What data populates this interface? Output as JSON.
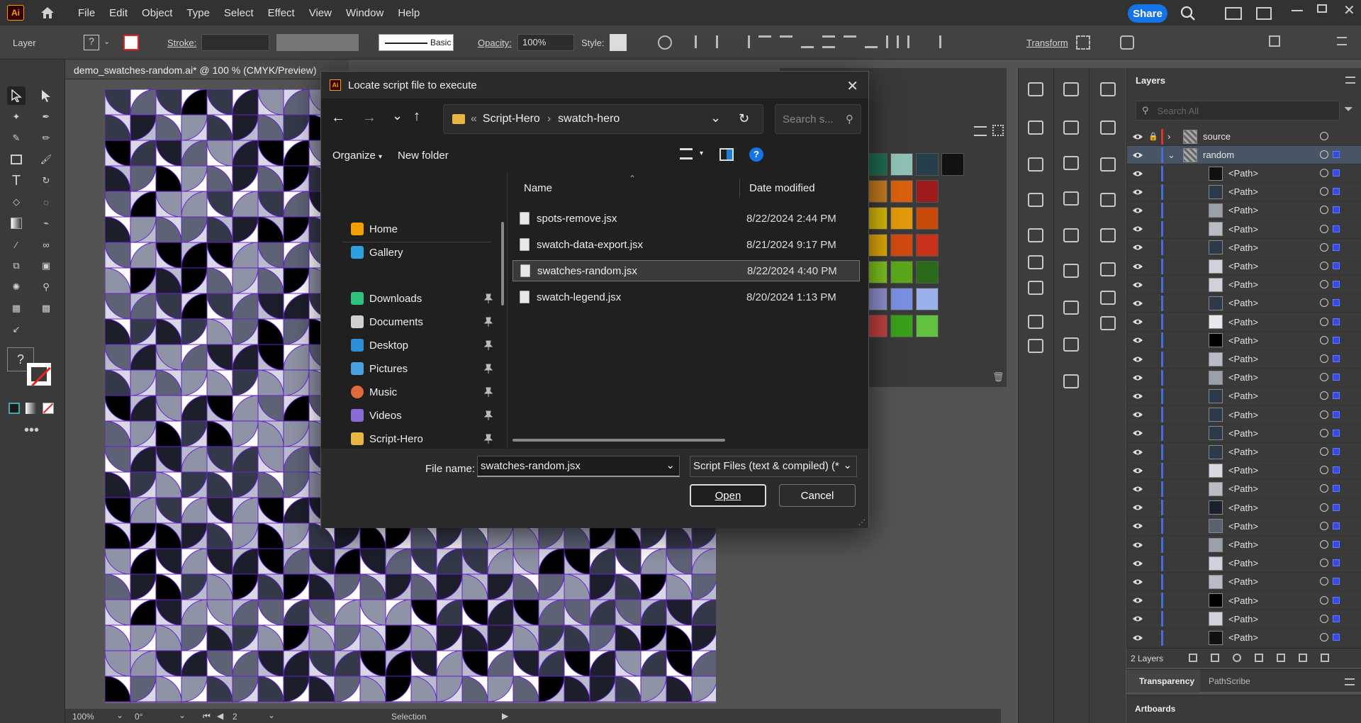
{
  "app": {
    "logo": "Ai",
    "menu": [
      "File",
      "Edit",
      "Object",
      "Type",
      "Select",
      "Effect",
      "View",
      "Window",
      "Help"
    ],
    "share_label": "Share"
  },
  "control_bar": {
    "layer_label": "Layer",
    "stroke_label": "Stroke:",
    "brush_label": "Basic",
    "opacity_label": "Opacity:",
    "opacity_value": "100%",
    "style_label": "Style:",
    "transform_label": "Transform"
  },
  "document": {
    "tab_title": "demo_swatches-random.ai* @ 100 % (CMYK/Preview)"
  },
  "status_bar": {
    "zoom": "100%",
    "rotation": "0°",
    "artboard_number": "2",
    "tool_name": "Selection"
  },
  "dialog": {
    "title": "Locate script file to execute",
    "breadcrumb": [
      "Script-Hero",
      "swatch-hero"
    ],
    "search_placeholder": "Search s...",
    "organize_label": "Organize",
    "new_folder_label": "New folder",
    "columns": {
      "name": "Name",
      "date": "Date modified"
    },
    "nav_items": [
      {
        "label": "Home",
        "icon": "home-icon"
      },
      {
        "label": "Gallery",
        "icon": "gallery-icon"
      },
      {
        "label": "Downloads",
        "icon": "download-icon"
      },
      {
        "label": "Documents",
        "icon": "documents-icon"
      },
      {
        "label": "Desktop",
        "icon": "desktop-icon"
      },
      {
        "label": "Pictures",
        "icon": "pictures-icon"
      },
      {
        "label": "Music",
        "icon": "music-icon"
      },
      {
        "label": "Videos",
        "icon": "videos-icon"
      },
      {
        "label": "Script-Hero",
        "icon": "folder-icon"
      }
    ],
    "files": [
      {
        "name": "spots-remove.jsx",
        "date": "8/22/2024 2:44 PM"
      },
      {
        "name": "swatch-data-export.jsx",
        "date": "8/21/2024 9:17 PM"
      },
      {
        "name": "swatches-random.jsx",
        "date": "8/22/2024 4:40 PM"
      },
      {
        "name": "swatch-legend.jsx",
        "date": "8/20/2024 1:13 PM"
      }
    ],
    "selected_index": 2,
    "file_name_label": "File name:",
    "file_name_value": "swatches-random.jsx",
    "file_type_value": "Script Files (text & compiled) (*",
    "open_label": "Open",
    "cancel_label": "Cancel"
  },
  "layers_panel": {
    "title": "Layers",
    "search_placeholder": "Search All",
    "layers": [
      {
        "name": "source",
        "expanded": false
      },
      {
        "name": "random",
        "expanded": true
      }
    ],
    "sublayer_label": "<Path>",
    "layer_count": "2 Layers"
  },
  "bottom_panels": {
    "tabs": [
      "Transparency",
      "PathScribe"
    ],
    "artboards_label": "Artboards"
  },
  "swatch_colors": [
    "#1e6b4f",
    "#8fc2b4",
    "#263d4a",
    "#121212",
    "#c47a1e",
    "#d9600f",
    "#9e1c1c",
    "#d8b80a",
    "#e09a0a",
    "#c94a0a",
    "#e0a80a",
    "#d04a10",
    "#c8321a",
    "#7fc21e",
    "#5aa81a",
    "#2a6a1a",
    "#8f8fd0",
    "#7a8fe0",
    "#9ab0ea",
    "#c04040",
    "#3aa01a",
    "#60c040"
  ],
  "colors": {
    "accent": "#1473e6",
    "selection_outline": "#6a1fd6",
    "ai_logo": "#ff9a00"
  }
}
